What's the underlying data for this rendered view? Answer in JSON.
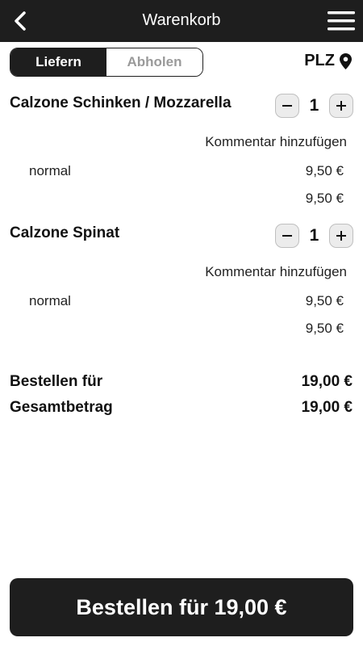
{
  "header": {
    "title": "Warenkorb",
    "back_icon": "chevron-left-icon",
    "menu_icon": "hamburger-menu-icon"
  },
  "delivery_toggle": {
    "options": [
      "Liefern",
      "Abholen"
    ],
    "selected": "Liefern"
  },
  "plz": {
    "label": "PLZ",
    "icon": "map-pin-icon"
  },
  "cart": {
    "items": [
      {
        "name": "Calzone Schinken / Mozzarella",
        "quantity": "1",
        "comment_link": "Kommentar hinzufügen",
        "option": "normal",
        "option_price": "9,50 €",
        "total": "9,50 €"
      },
      {
        "name": "Calzone Spinat",
        "quantity": "1",
        "comment_link": "Kommentar hinzufügen",
        "option": "normal",
        "option_price": "9,50 €",
        "total": "9,50 €"
      }
    ]
  },
  "summary": {
    "order_for_label": "Bestellen für",
    "order_for_value": "19,00 €",
    "total_label": "Gesamtbetrag",
    "total_value": "19,00 €"
  },
  "order_button": {
    "label": "Bestellen für 19,00 €"
  },
  "colors": {
    "dark": "#1e1e1e",
    "inactive_text": "#9a9a9a",
    "stepper_bg": "#ececec"
  }
}
